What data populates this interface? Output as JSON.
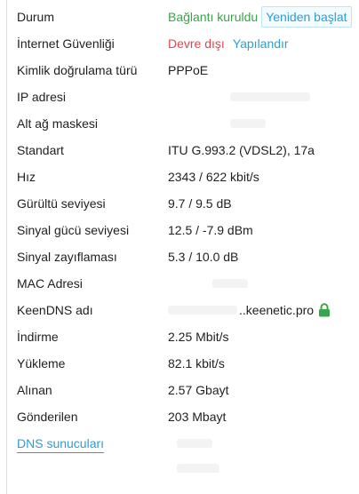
{
  "status": {
    "label": "Durum",
    "value": "Bağlantı kuruldu",
    "restart_button": "Yeniden başlat"
  },
  "internet_security": {
    "label": "İnternet Güvenliği",
    "value": "Devre dışı",
    "configure_link": "Yapılandır"
  },
  "auth_type": {
    "label": "Kimlik doğrulama türü",
    "value": "PPPoE"
  },
  "ip_address": {
    "label": "IP adresi"
  },
  "subnet_mask": {
    "label": "Alt ağ maskesi"
  },
  "standard": {
    "label": "Standart",
    "value": "ITU G.993.2 (VDSL2), 17a"
  },
  "speed": {
    "label": "Hız",
    "value": "2343 / 622 kbit/s"
  },
  "noise": {
    "label": "Gürültü seviyesi",
    "value": "9.7 / 9.5 dB"
  },
  "signal_power": {
    "label": "Sinyal gücü seviyesi",
    "value": "12.5 / -7.9 dBm"
  },
  "attenuation": {
    "label": "Sinyal zayıflaması",
    "value": "5.3 / 10.0 dB"
  },
  "mac_address": {
    "label": "MAC Adresi"
  },
  "keendns": {
    "label": "KeenDNS adı",
    "value": "..keenetic.pro",
    "lock_icon": "lock-icon",
    "lock_color": "#3aa44a"
  },
  "download": {
    "label": "İndirme",
    "value": "2.25 Mbit/s"
  },
  "upload": {
    "label": "Yükleme",
    "value": "82.1 kbit/s"
  },
  "received": {
    "label": "Alınan",
    "value": "2.57 Gbayt"
  },
  "sent": {
    "label": "Gönderilen",
    "value": "203 Mbayt"
  },
  "dns_servers": {
    "label": "DNS sunucuları"
  },
  "colors": {
    "ok": "#3aa44a",
    "error": "#e2444a",
    "link": "#2a9fd6",
    "text": "#1f1f1f"
  }
}
